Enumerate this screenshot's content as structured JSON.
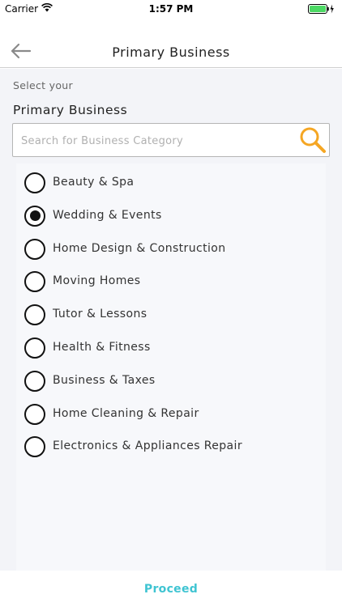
{
  "status_bar": {
    "carrier": "Carrier",
    "time": "1:57 PM",
    "battery_color": "#4cd964"
  },
  "nav": {
    "title": "Primary Business",
    "back_icon": "arrow-left-icon"
  },
  "form": {
    "prompt": "Select your",
    "heading": "Primary Business",
    "search_placeholder": "Search for Business Category",
    "search_value": "",
    "search_icon": "magnifier-icon",
    "search_icon_color": "#f5a623"
  },
  "categories": [
    {
      "label": "Beauty & Spa",
      "selected": false
    },
    {
      "label": "Wedding & Events",
      "selected": true
    },
    {
      "label": "Home Design & Construction",
      "selected": false
    },
    {
      "label": "Moving Homes",
      "selected": false
    },
    {
      "label": "Tutor & Lessons",
      "selected": false
    },
    {
      "label": "Health & Fitness",
      "selected": false
    },
    {
      "label": "Business & Taxes",
      "selected": false
    },
    {
      "label": "Home Cleaning & Repair",
      "selected": false
    },
    {
      "label": "Electronics & Appliances Repair",
      "selected": false
    }
  ],
  "footer": {
    "proceed_label": "Proceed",
    "accent_color": "#3fc4d2"
  }
}
